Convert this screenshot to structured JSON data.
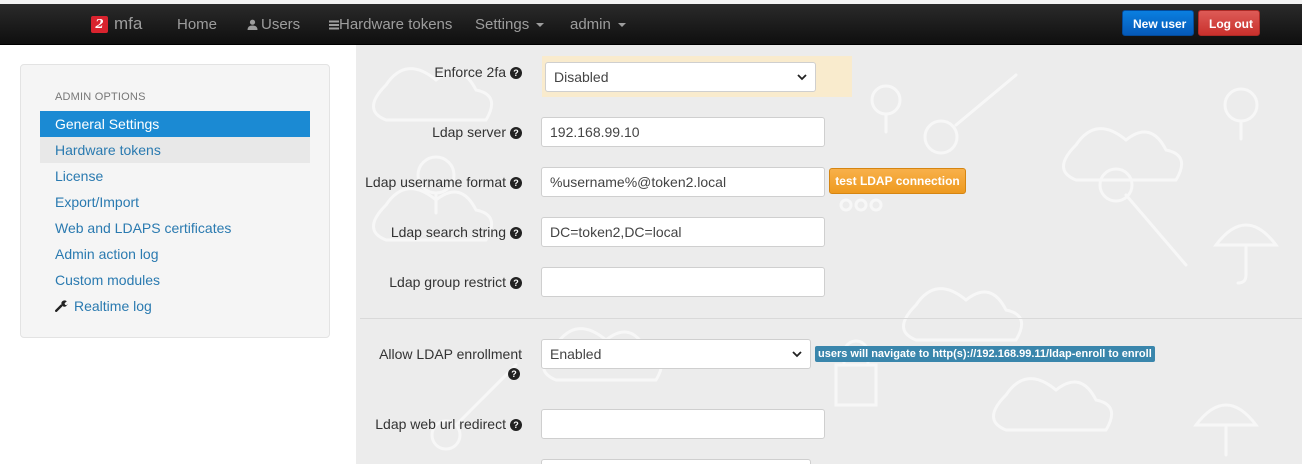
{
  "nav": {
    "brand": "mfa",
    "brand_logo_glyph": "2",
    "links": {
      "home": "Home",
      "users": "Users",
      "hardware_tokens": "Hardware tokens",
      "settings": "Settings",
      "admin": "admin"
    },
    "new_user": "New user",
    "log_out": "Log out"
  },
  "sidebar": {
    "header": "ADMIN OPTIONS",
    "items": [
      {
        "label": "General Settings"
      },
      {
        "label": "Hardware tokens"
      },
      {
        "label": "License"
      },
      {
        "label": "Export/Import"
      },
      {
        "label": "Web and LDAPS certificates"
      },
      {
        "label": "Admin action log"
      },
      {
        "label": "Custom modules"
      },
      {
        "label": "Realtime log"
      }
    ]
  },
  "form": {
    "enforce_2fa": {
      "label": "Enforce 2fa",
      "value": "Disabled"
    },
    "ldap_server": {
      "label": "Ldap server",
      "value": "192.168.99.10"
    },
    "ldap_username_format": {
      "label": "Ldap username format",
      "value": "%username%@token2.local"
    },
    "test_ldap": "test LDAP connection",
    "ldap_search_string": {
      "label": "Ldap search string",
      "value": "DC=token2,DC=local"
    },
    "ldap_group_restrict": {
      "label": "Ldap group restrict",
      "value": ""
    },
    "allow_ldap_enrollment": {
      "label": "Allow LDAP enrollment",
      "value": "Enabled"
    },
    "enroll_badge": "users will navigate to http(s)://192.168.99.11/ldap-enroll to enroll",
    "ldap_web_url_redirect": {
      "label": "Ldap web url redirect",
      "value": ""
    },
    "help_glyph": "?"
  },
  "colors": {
    "navbar": "#111111",
    "active": "#1b8ad3",
    "link": "#2a7ab0",
    "test_button": "#f0a030",
    "badge": "#3a86ac"
  }
}
